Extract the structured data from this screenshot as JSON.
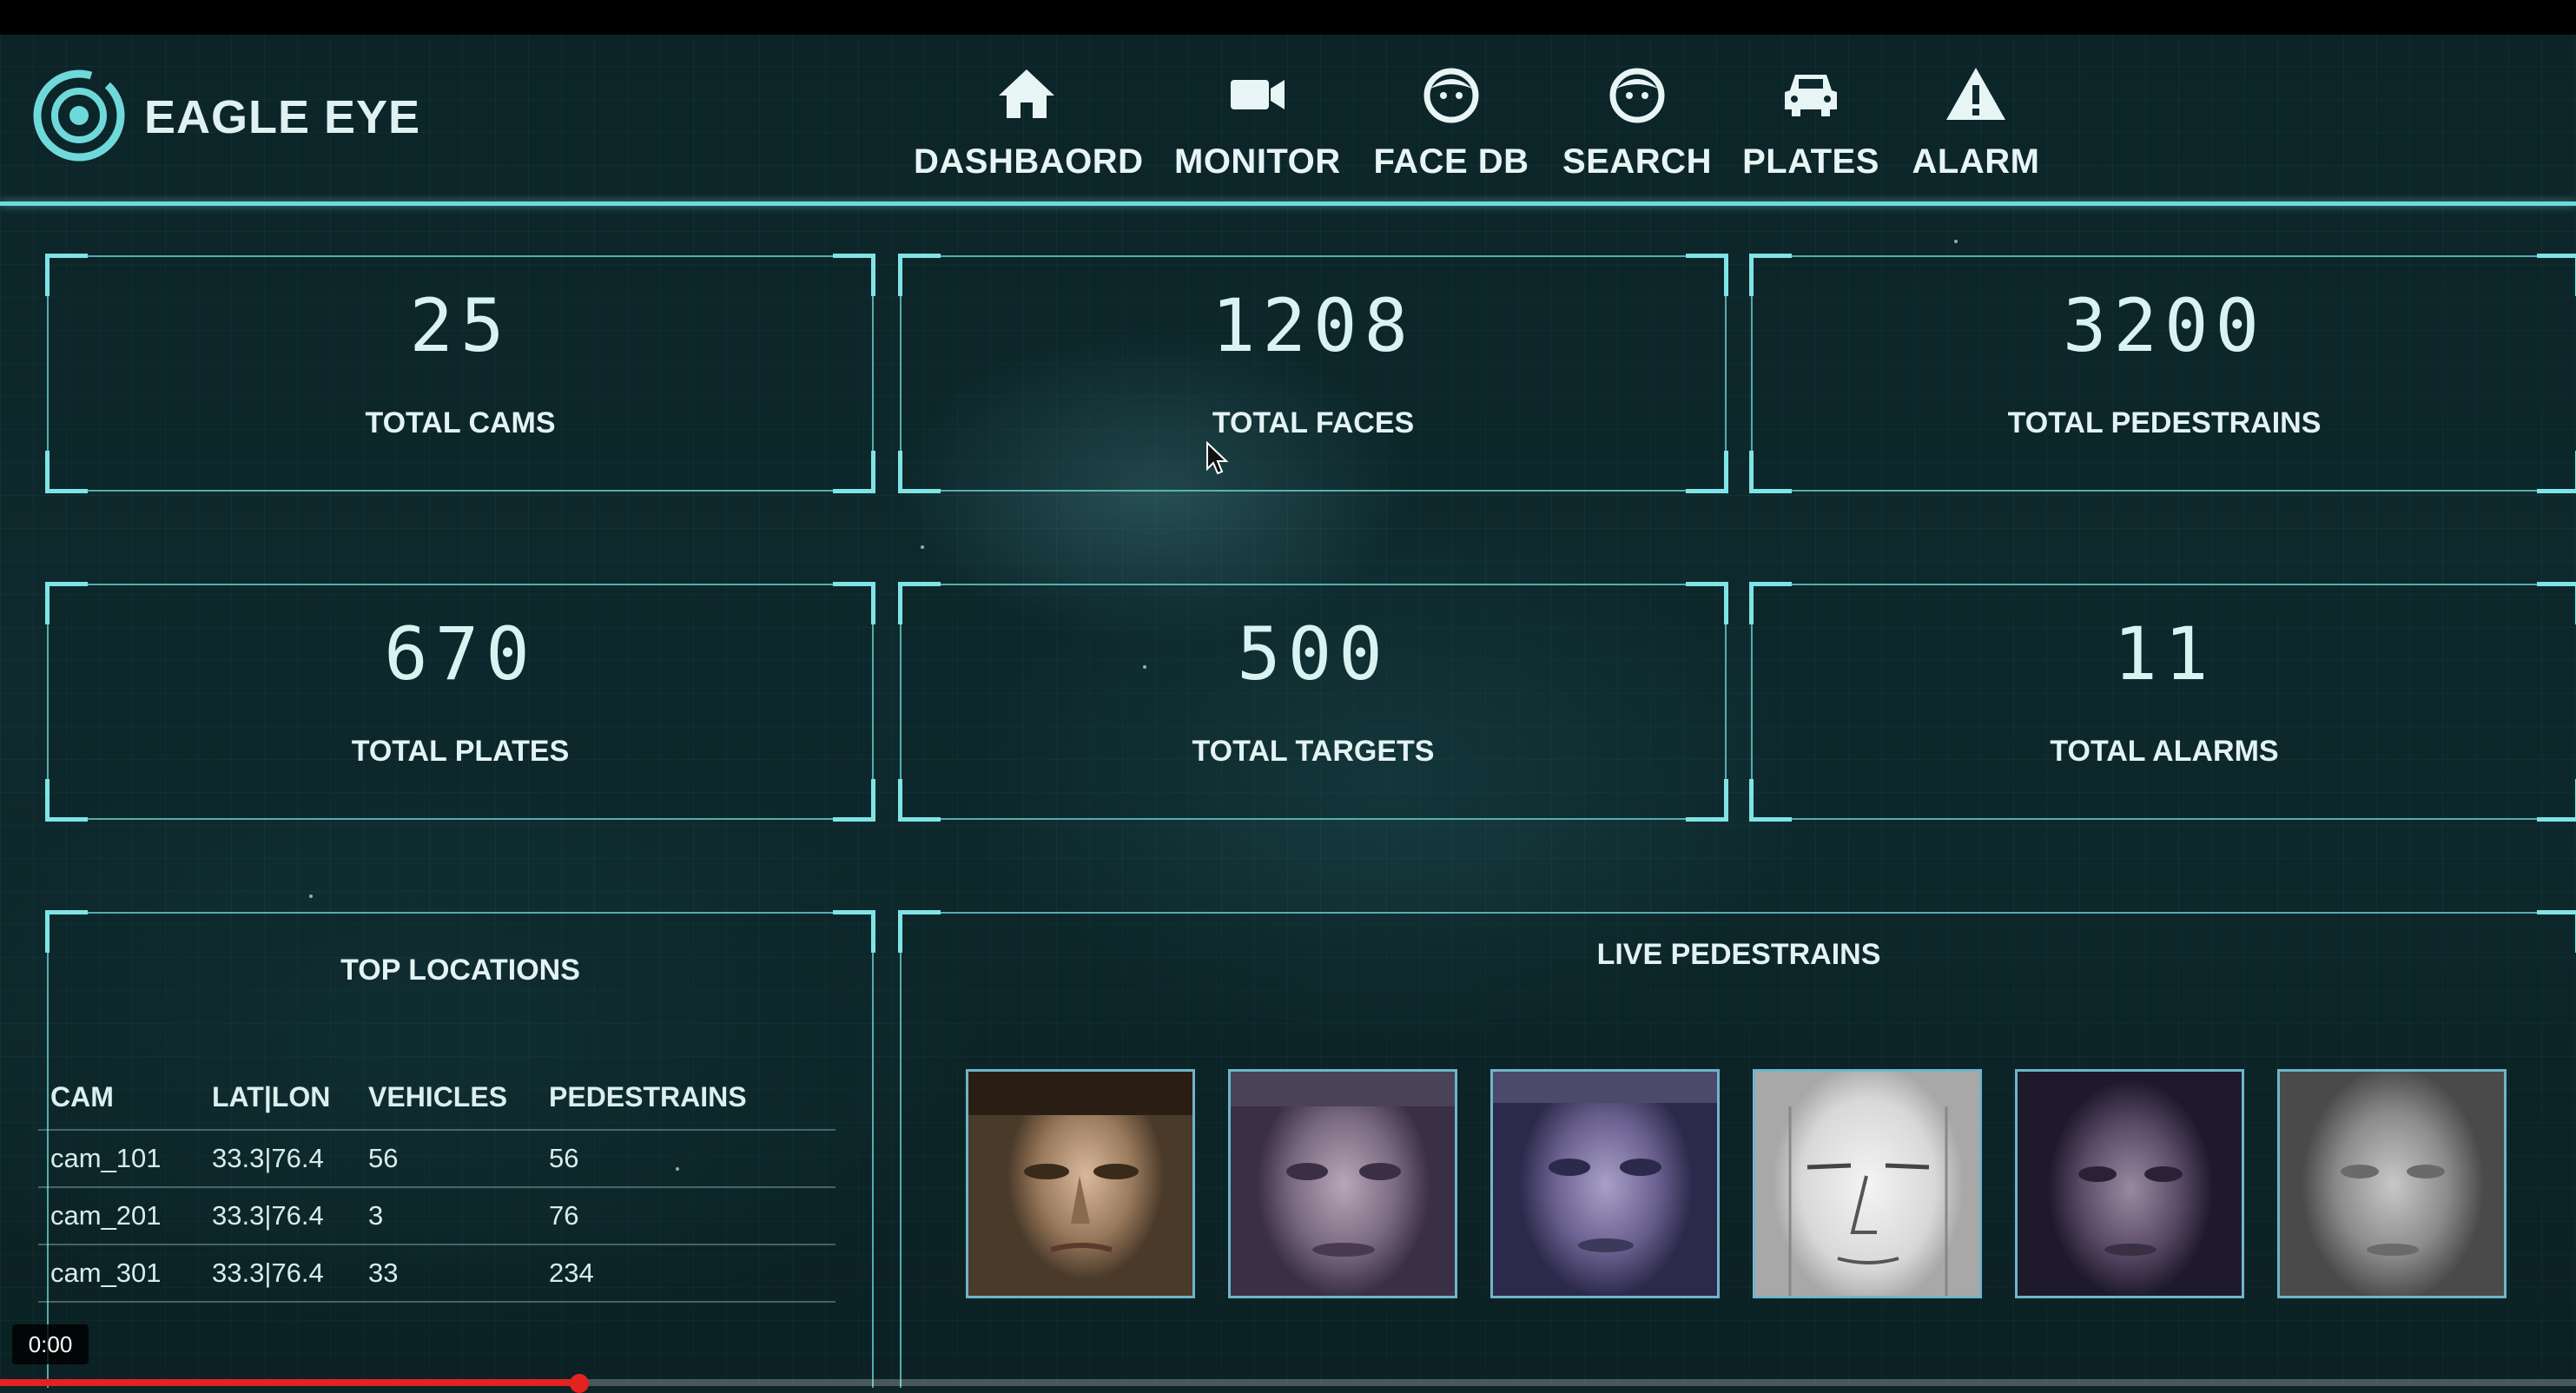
{
  "app": {
    "brand": "EAGLE EYE"
  },
  "nav": [
    {
      "label": "DASHBAORD",
      "icon": "home-icon"
    },
    {
      "label": "MONITOR",
      "icon": "video-camera-icon"
    },
    {
      "label": "FACE DB",
      "icon": "face-icon"
    },
    {
      "label": "SEARCH",
      "icon": "face-search-icon"
    },
    {
      "label": "PLATES",
      "icon": "car-icon"
    },
    {
      "label": "ALARM",
      "icon": "warning-icon"
    }
  ],
  "stats": [
    {
      "value": "25",
      "label": "TOTAL CAMS"
    },
    {
      "value": "1208",
      "label": "TOTAL FACES"
    },
    {
      "value": "3200",
      "label": "TOTAL PEDESTRAINS"
    },
    {
      "value": "670",
      "label": "TOTAL PLATES"
    },
    {
      "value": "500",
      "label": "TOTAL TARGETS"
    },
    {
      "value": "11",
      "label": "TOTAL ALARMS"
    }
  ],
  "top_locations": {
    "title": "TOP LOCATIONS",
    "columns": [
      "CAM",
      "LAT|LON",
      "VEHICLES",
      "PEDESTRAINS"
    ],
    "rows": [
      [
        "cam_101",
        "33.3|76.4",
        "56",
        "56"
      ],
      [
        "cam_201",
        "33.3|76.4",
        "3",
        "76"
      ],
      [
        "cam_301",
        "33.3|76.4",
        "33",
        "234"
      ]
    ]
  },
  "live_pedestrians": {
    "title": "LIVE PEDESTRAINS",
    "thumbnails": [
      "face-thumbnail",
      "face-thumbnail",
      "face-thumbnail",
      "face-thumbnail",
      "face-thumbnail",
      "face-thumbnail"
    ]
  },
  "video": {
    "time": "0:00",
    "progress": 0.225
  },
  "colors": {
    "accent": "#6fd9da",
    "background": "#0d2528",
    "progress": "#e52222"
  }
}
